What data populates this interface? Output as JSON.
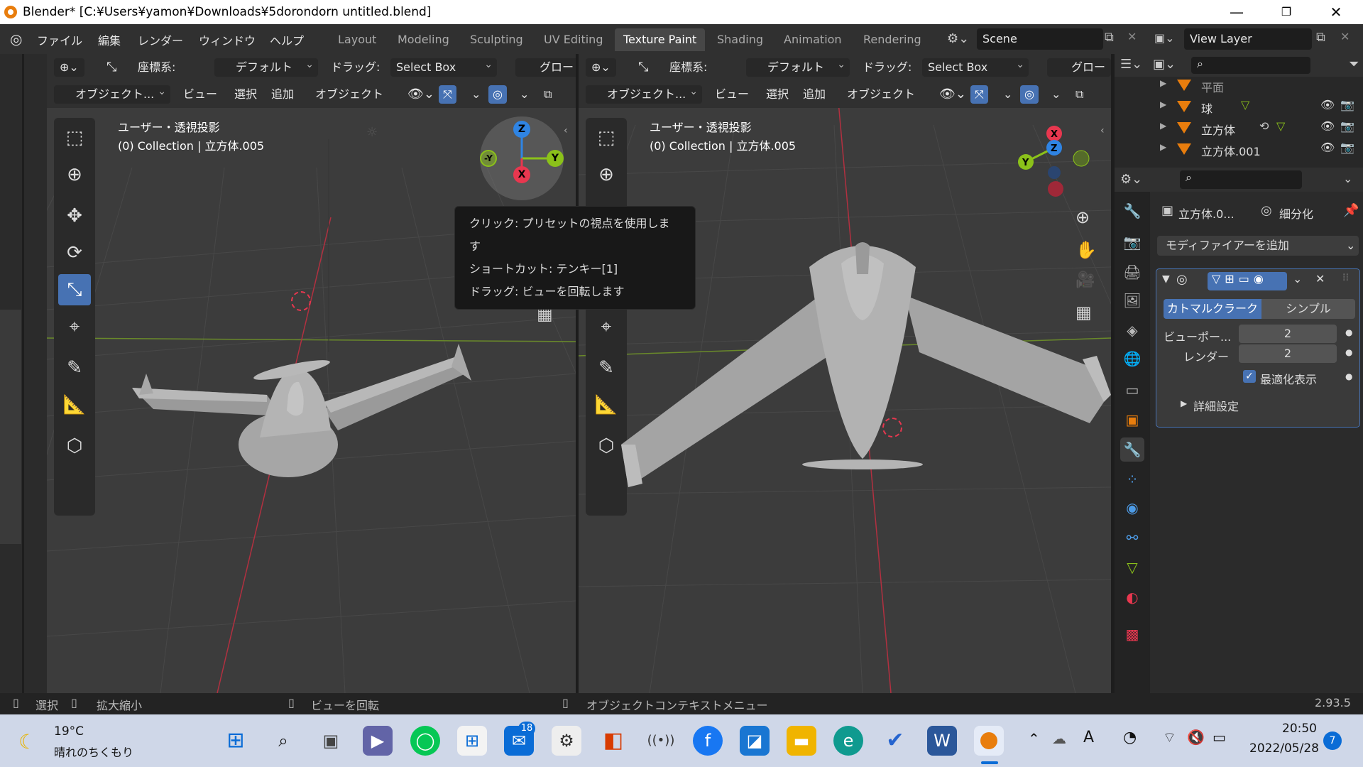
{
  "window": {
    "title": "Blender* [C:¥Users¥yamon¥Downloads¥5dorondorn untitled.blend]"
  },
  "menu": [
    "ファイル",
    "編集",
    "レンダー",
    "ウィンドウ",
    "ヘルプ"
  ],
  "workspace_tabs": [
    "Layout",
    "Modeling",
    "Sculpting",
    "UV Editing",
    "Texture Paint",
    "Shading",
    "Animation",
    "Rendering"
  ],
  "active_workspace": "Texture Paint",
  "scene": "Scene",
  "view_layer": "View Layer",
  "viewport_left": {
    "orient_label": "座標系:",
    "orient_value": "デフォルト",
    "drag_label": "ドラッグ:",
    "drag_value": "Select Box",
    "global": "グロー",
    "mode": "オブジェクト...",
    "menus": [
      "ビュー",
      "選択",
      "追加",
      "オブジェクト"
    ],
    "view_name": "ユーザー・透視投影",
    "collection": "(0) Collection | 立方体.005"
  },
  "viewport_right": {
    "orient_label": "座標系:",
    "orient_value": "デフォルト",
    "drag_label": "ドラッグ:",
    "drag_value": "Select Box",
    "global": "グロー",
    "mode": "オブジェクト...",
    "menus": [
      "ビュー",
      "選択",
      "追加",
      "オブジェクト"
    ],
    "view_name": "ユーザー・透視投影",
    "collection": "(0) Collection | 立方体.005"
  },
  "gizmo": {
    "z": "Z",
    "y": "Y",
    "neg_y": "-Y",
    "x": "X"
  },
  "tooltip": {
    "line1": "クリック: プリセットの視点を使用します",
    "line2": "ショートカット: テンキー[1]",
    "line3": "ドラッグ: ビューを回転します"
  },
  "outliner": {
    "rows": [
      "平面",
      "球",
      "立方体",
      "立方体.001"
    ]
  },
  "properties": {
    "object_name": "立方体.0...",
    "modifier_name": "細分化",
    "add_modifier": "モディファイアーを追加",
    "tab_catmull": "カトマルクラーク",
    "tab_simple": "シンプル",
    "viewport_label": "ビューポー...",
    "viewport_value": "2",
    "render_label": "レンダー",
    "render_value": "2",
    "optimal_display": "最適化表示",
    "advanced": "詳細設定"
  },
  "statusbar": {
    "select": "選択",
    "zoom": "拡大縮小",
    "rotate": "ビューを回転",
    "context": "オブジェクトコンテキストメニュー",
    "version": "2.93.5"
  },
  "taskbar": {
    "temp": "19°C",
    "weather": "晴れのちくもり",
    "mail_badge": "18",
    "time": "20:50",
    "date": "2022/05/28",
    "notif": "7",
    "ime": "A"
  },
  "colors": {
    "accent": "#4772b3",
    "x_axis": "#e8374f",
    "y_axis": "#8bc11a",
    "z_axis": "#2f84e3",
    "blender_orange": "#e87d0d"
  }
}
